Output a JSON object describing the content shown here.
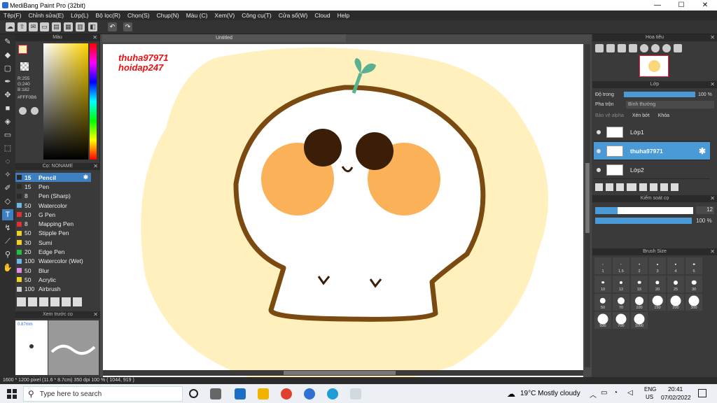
{
  "window": {
    "title": "MediBang Paint Pro (32bit)"
  },
  "menu": [
    "Tệp(F)",
    "Chỉnh sửa(E)",
    "Lớp(L)",
    "Bộ lọc(R)",
    "Chọn(S)",
    "Chụp(N)",
    "Màu (C)",
    "Xem(V)",
    "Công cụ(T)",
    "Cửa sổ(W)",
    "Cloud",
    "Help"
  ],
  "color_panel": {
    "title": "Màu",
    "r": "R:255",
    "g": "G:240",
    "b": "B:182",
    "hex": "#FFF0B6"
  },
  "brush_panel": {
    "title": "Cọ: NONAME",
    "items": [
      {
        "size": "15",
        "name": "Pencil",
        "color": "#2a2a2a"
      },
      {
        "size": "15",
        "name": "Pen",
        "color": "#2a2a2a"
      },
      {
        "size": "8",
        "name": "Pen (Sharp)",
        "color": "#2a2a2a"
      },
      {
        "size": "50",
        "name": "Watercolor",
        "color": "#6ab8e8"
      },
      {
        "size": "10",
        "name": "G Pen",
        "color": "#e03030"
      },
      {
        "size": "8",
        "name": "Mapping Pen",
        "color": "#e03030"
      },
      {
        "size": "50",
        "name": "Stipple Pen",
        "color": "#f0d020"
      },
      {
        "size": "30",
        "name": "Sumi",
        "color": "#f0d020"
      },
      {
        "size": "20",
        "name": "Edge Pen",
        "color": "#20c040"
      },
      {
        "size": "100",
        "name": "Watercolor (Wet)",
        "color": "#6ab8e8"
      },
      {
        "size": "50",
        "name": "Blur",
        "color": "#e888e8"
      },
      {
        "size": "50",
        "name": "Acrylic",
        "color": "#f0d020"
      },
      {
        "size": "100",
        "name": "Airbrush",
        "color": "#cccccc"
      }
    ]
  },
  "preview_panel": {
    "title": "Xem trước cọ",
    "size": "0.87mm"
  },
  "canvas": {
    "tab": "Untitled",
    "watermark1": "thuha97971",
    "watermark2": "hoidap247"
  },
  "navigator": {
    "title": "Hoa tiêu"
  },
  "layer_panel": {
    "title": "Lớp",
    "opacity_label": "Độ trong",
    "opacity_value": "100 %",
    "blend_label": "Pha trộn",
    "blend_value": "Bình thường",
    "protect_alpha": "Bảo vệ alpha",
    "clipping": "Xén bớt",
    "lock": "Khóa",
    "layers": [
      {
        "name": "Lớp1",
        "selected": false
      },
      {
        "name": "thuha97971",
        "selected": true
      },
      {
        "name": "Lớp2",
        "selected": false
      }
    ]
  },
  "brush_control": {
    "title": "Kiểm soát cọ",
    "size": "12",
    "opacity": "100 %"
  },
  "brush_size": {
    "title": "Brush Size",
    "sizes": [
      "1",
      "1.5",
      "2",
      "3",
      "4",
      "5",
      "10",
      "12",
      "15",
      "20",
      "25",
      "30",
      "50",
      "70",
      "100",
      "150",
      "200",
      "300",
      "500",
      "700",
      "1000"
    ]
  },
  "status": {
    "text": "1600 * 1200 pixel   (11.6 * 8.7cm)   350 dpi   100 %   ( 1044, 919 )"
  },
  "taskbar": {
    "search_placeholder": "Type here to search",
    "weather": "19°C  Mostly cloudy",
    "lang1": "ENG",
    "lang2": "US",
    "time": "20:41",
    "date": "07/02/2022"
  }
}
